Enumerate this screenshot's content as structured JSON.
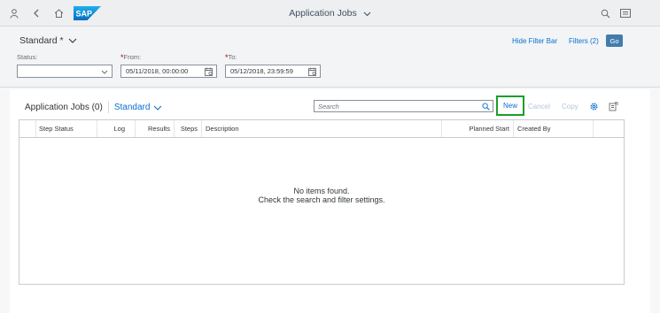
{
  "shell": {
    "title": "Application Jobs",
    "icons": [
      "person-icon",
      "back-icon",
      "home-icon",
      "sap-logo",
      "search-icon",
      "notifications-icon"
    ]
  },
  "filterbar": {
    "variant": "Standard *",
    "hide_filter_bar": "Hide Filter Bar",
    "filters": "Filters (2)",
    "go": "Go",
    "status_label": "Status:",
    "status_value": "",
    "from_label": "From:",
    "from_value": "05/11/2018, 00:00:00",
    "to_label": "To:",
    "to_value": "05/12/2018, 23:59:59",
    "required_marker": "*"
  },
  "table": {
    "title": "Application Jobs (0)",
    "variant": "Standard",
    "search_placeholder": "Search",
    "new": "New",
    "cancel": "Cancel",
    "copy": "Copy",
    "columns": [
      "Step Status",
      "Log",
      "Results",
      "Steps",
      "Description",
      "Planned Start",
      "Created By"
    ],
    "empty_line1": "No items found.",
    "empty_line2": "Check the search and filter settings."
  },
  "colors": {
    "accent": "#0a6ed1",
    "go_button": "#427cac",
    "highlight_border": "#1a9e2a",
    "required": "#bb0000"
  }
}
